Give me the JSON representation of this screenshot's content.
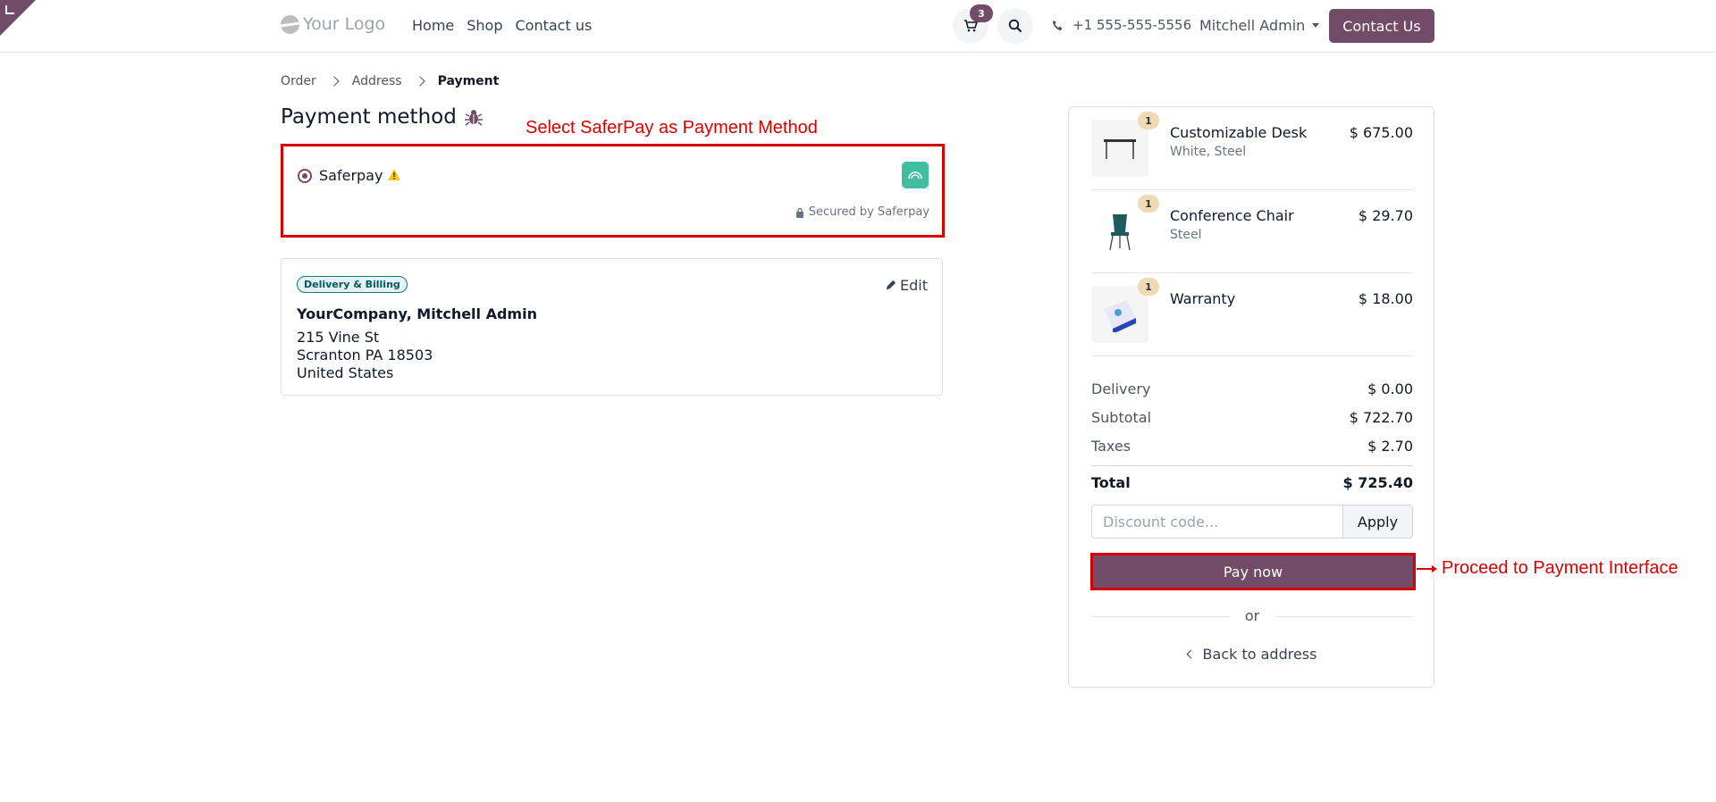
{
  "header": {
    "logo_text": "Your Logo",
    "nav": [
      "Home",
      "Shop",
      "Contact us"
    ],
    "cart_count": "3",
    "phone": "+1 555-555-5556",
    "user": "Mitchell Admin",
    "contact_button": "Contact Us"
  },
  "breadcrumb": [
    "Order",
    "Address",
    "Payment"
  ],
  "payment": {
    "title": "Payment method",
    "method_label": "Saferpay",
    "secured_text": "Secured by Saferpay"
  },
  "address": {
    "badge": "Delivery & Billing",
    "edit_label": "Edit",
    "name": "YourCompany, Mitchell Admin",
    "line1": "215 Vine St",
    "line2": "Scranton PA 18503",
    "line3": "United States"
  },
  "summary": {
    "items": [
      {
        "qty": "1",
        "name": "Customizable Desk",
        "sub": "White, Steel",
        "price": "$ 675.00"
      },
      {
        "qty": "1",
        "name": "Conference Chair",
        "sub": "Steel",
        "price": "$ 29.70"
      },
      {
        "qty": "1",
        "name": "Warranty",
        "sub": "",
        "price": "$ 18.00"
      }
    ],
    "delivery_label": "Delivery",
    "delivery": "$ 0.00",
    "subtotal_label": "Subtotal",
    "subtotal": "$ 722.70",
    "taxes_label": "Taxes",
    "taxes": "$ 2.70",
    "total_label": "Total",
    "total": "$ 725.40",
    "discount_placeholder": "Discount code...",
    "apply_label": "Apply",
    "pay_label": "Pay now",
    "or_label": "or",
    "back_label": "Back to address"
  },
  "annotations": {
    "top": "Select SaferPay as Payment Method",
    "right": "Proceed to Payment Interface"
  },
  "colors": {
    "brand": "#714b67",
    "annotation": "#d90000",
    "badge": "#017e84"
  }
}
